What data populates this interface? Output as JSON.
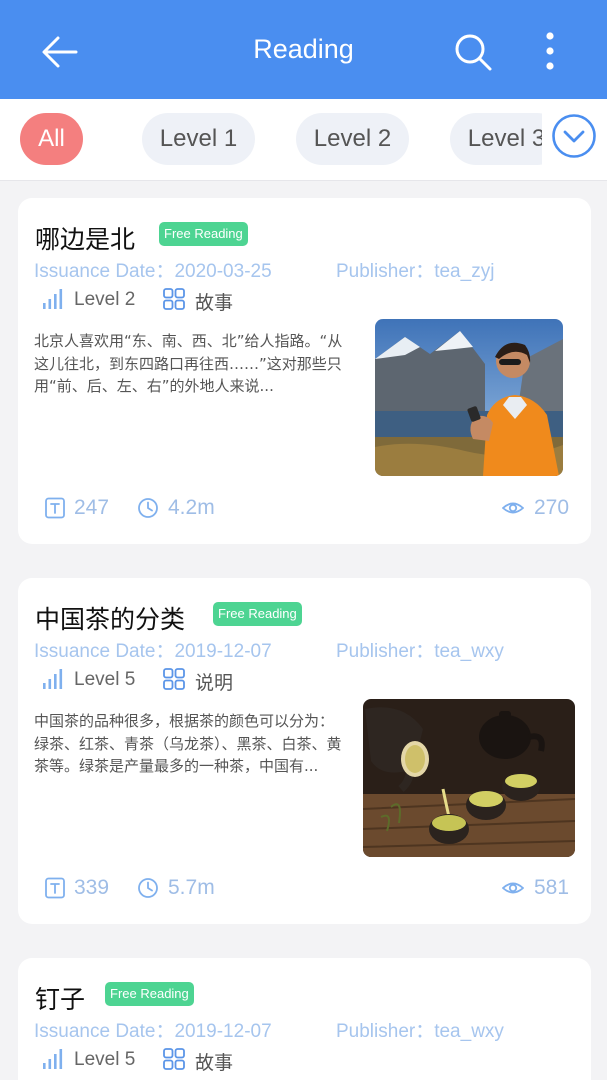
{
  "appbar": {
    "title": "Reading",
    "back_icon": "arrow-left-icon",
    "search_icon": "search-icon",
    "more_icon": "more-vert-icon",
    "color": "#4a8ef0"
  },
  "filters": {
    "chips": [
      "All",
      "Level 1",
      "Level 2",
      "Level 3"
    ],
    "selected": "All",
    "expand_icon": "chevron-down-circle-icon",
    "active_color": "#f47f7f"
  },
  "articles": [
    {
      "title": "哪边是北",
      "badge": "Free Reading",
      "date": "Issuance Date：2020-03-25",
      "publisher": "Publisher：tea_zyj",
      "level": "Level 2",
      "category": "故事",
      "excerpt": "北京人喜欢用“东、南、西、北”给人指路。“从这儿往北，到东四路口再往西……”这对那些只用“前、后、左、右”的外地人来说...",
      "words": "247",
      "duration": "4.2m",
      "views": "270",
      "image": "man-with-compass-photo"
    },
    {
      "title": "中国茶的分类",
      "badge": "Free Reading",
      "date": "Issuance Date：2019-12-07",
      "publisher": "Publisher：tea_wxy",
      "level": "Level 5",
      "category": "说明",
      "excerpt": "中国茶的品种很多，根据茶的颜色可以分为：绿茶、红茶、青茶（乌龙茶）、黑茶、白茶、黄茶等。绿茶是产量最多的一种茶，中国有...",
      "words": "339",
      "duration": "5.7m",
      "views": "581",
      "image": "tea-pouring-photo"
    },
    {
      "title": "钉子",
      "badge": "Free Reading",
      "date": "Issuance Date：2019-12-07",
      "publisher": "Publisher：tea_wxy",
      "level": "Level 5",
      "category": "故事"
    }
  ]
}
